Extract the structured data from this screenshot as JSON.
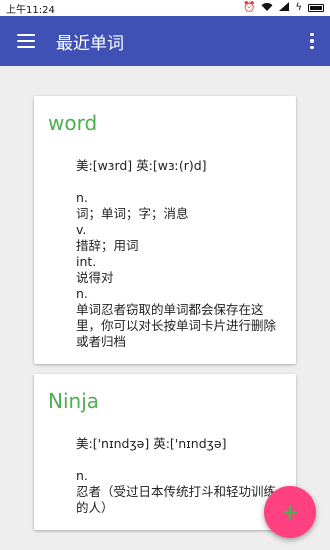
{
  "status": {
    "time": "上午11:24",
    "icons": [
      "alarm-icon",
      "wifi-icon",
      "signal-icon",
      "charging-icon",
      "battery-icon"
    ]
  },
  "toolbar": {
    "title": "最近单词",
    "menu_icon": "hamburger-icon",
    "more_icon": "more-vert-icon",
    "background": "#3f51b5"
  },
  "cards": [
    {
      "word": "word",
      "pronunciation": "美:[wɜrd] 英:[wɜː(r)d]",
      "lines": [
        "n.",
        "词；单词；字；消息",
        "v.",
        "措辞；用词",
        "int.",
        "说得对",
        "n.",
        "单词忍者窃取的单词都会保存在这里，你可以对长按单词卡片进行删除或者归档"
      ]
    },
    {
      "word": "Ninja",
      "pronunciation": "美:['nɪndʒə] 英:['nɪndʒə]",
      "lines": [
        "n.",
        "忍者（受过日本传统打斗和轻功训练的人）"
      ]
    }
  ],
  "fab": {
    "icon": "add-icon",
    "color": "#ff4081"
  },
  "accent_color": "#4caf50"
}
